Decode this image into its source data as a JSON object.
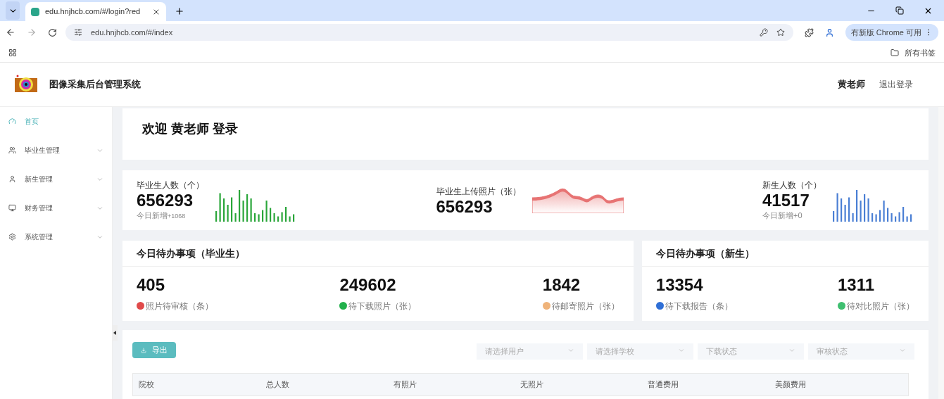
{
  "browser": {
    "tab_title": "edu.hnjhcb.com/#/login?red",
    "url": "edu.hnjhcb.com/#/index",
    "update_button": "有新版 Chrome 可用",
    "bookmarks_label": "所有书签"
  },
  "header": {
    "title": "图像采集后台管理系统",
    "user": "黄老师",
    "logout": "退出登录"
  },
  "sidebar": {
    "items": [
      {
        "label": "首页",
        "kind": "dashboard",
        "selected": true,
        "expandable": false
      },
      {
        "label": "毕业生管理",
        "kind": "users",
        "selected": false,
        "expandable": true
      },
      {
        "label": "新生管理",
        "kind": "user",
        "selected": false,
        "expandable": true
      },
      {
        "label": "财务管理",
        "kind": "finance",
        "selected": false,
        "expandable": true
      },
      {
        "label": "系统管理",
        "kind": "settings",
        "selected": false,
        "expandable": true
      }
    ]
  },
  "welcome": "欢迎 黄老师 登录",
  "stats": [
    {
      "label": "毕业生人数（个）",
      "value": "656293",
      "sub_label": "今日新增",
      "sub_value": "+1068",
      "kind": "bars",
      "color": "#2aa63a"
    },
    {
      "label": "毕业生上传照片（张）",
      "value": "656293",
      "kind": "wave",
      "color": "#e77373"
    },
    {
      "label": "新生人数（个）",
      "value": "41517",
      "sub_label": "今日新增+0",
      "kind": "bars",
      "color": "#4a7fd4"
    }
  ],
  "todo_panels": [
    {
      "title": "今日待办事项（毕业生）",
      "items": [
        {
          "value": "405",
          "label": "照片待审核（条）",
          "color": "#e04a4a"
        },
        {
          "value": "249602",
          "label": "待下载照片（张）",
          "color": "#21b04b"
        },
        {
          "value": "1842",
          "label": "待邮寄照片（张）",
          "color": "#efb37a"
        }
      ]
    },
    {
      "title": "今日待办事项（新生）",
      "items": [
        {
          "value": "13354",
          "label": "待下载报告（条）",
          "color": "#2f6fd6"
        },
        {
          "value": "1311",
          "label": "待对比照片（张）",
          "color": "#3fbf70"
        }
      ]
    }
  ],
  "table": {
    "export_button": "导出",
    "filters": [
      {
        "placeholder": "请选择用户"
      },
      {
        "placeholder": "请选择学校"
      },
      {
        "placeholder": "下载状态"
      },
      {
        "placeholder": "审核状态"
      }
    ],
    "columns": [
      "院校",
      "总人数",
      "有照片",
      "无照片",
      "普通费用",
      "美颜费用"
    ]
  }
}
